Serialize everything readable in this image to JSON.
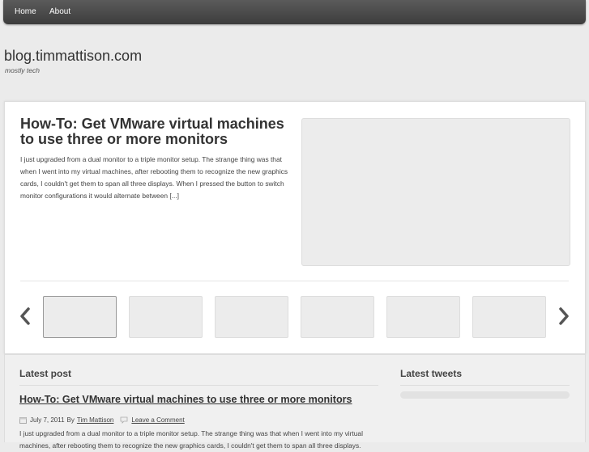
{
  "nav": {
    "items": [
      {
        "label": "Home"
      },
      {
        "label": "About"
      }
    ]
  },
  "site": {
    "title": "blog.timmattison.com",
    "tagline": "mostly tech"
  },
  "featured": {
    "title": "How-To: Get VMware virtual machines to use three or more monitors",
    "excerpt": "I just upgraded from a dual monitor to a triple monitor setup.  The strange thing was that when I went into my virtual machines, after rebooting them to recognize the new graphics cards, I couldn't get them to span all three displays.  When I pressed the button to switch monitor configurations it would alternate between [...]"
  },
  "latest_post": {
    "heading": "Latest post",
    "title": "How-To: Get VMware virtual machines to use three or more monitors",
    "date": "July 7, 2011",
    "by_label": "By",
    "author": "Tim Mattison",
    "comment_link": "Leave a Comment",
    "excerpt": "I just upgraded from a dual monitor to a triple monitor setup.  The strange thing was that when I went into my virtual machines, after rebooting them to recognize the new graphics cards, I couldn't get them to span all three displays."
  },
  "latest_tweets": {
    "heading": "Latest tweets"
  },
  "icons": {
    "prev": "chevron-left-icon",
    "next": "chevron-right-icon",
    "calendar": "calendar-icon",
    "comment": "comment-icon"
  },
  "colors": {
    "nav_bg": "#4a4a4a",
    "panel_bg": "#ffffff",
    "page_bg": "#ebebeb"
  }
}
